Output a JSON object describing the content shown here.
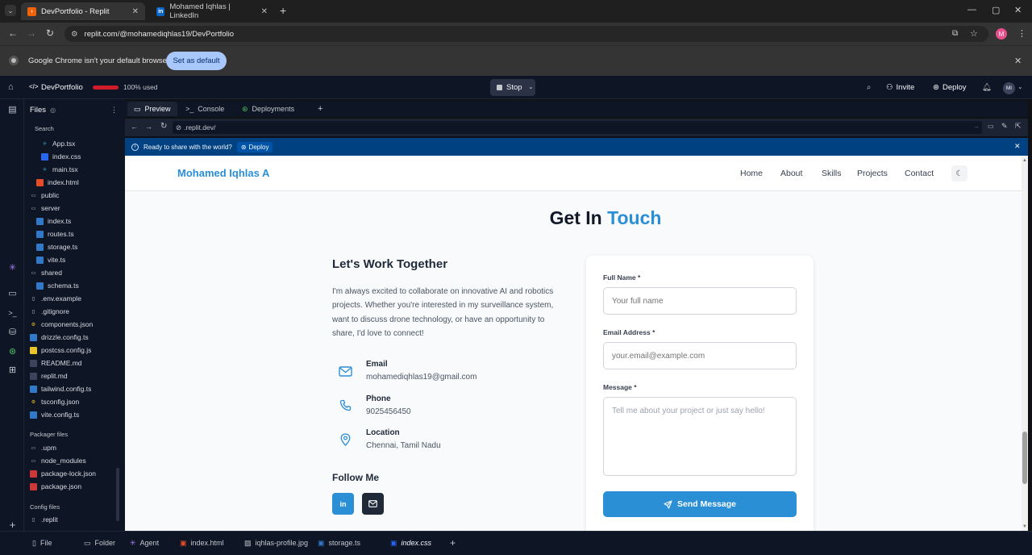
{
  "browser": {
    "tabs": [
      {
        "title": "DevPortfolio - Replit",
        "active": true
      },
      {
        "title": "Mohamed Iqhlas | LinkedIn",
        "active": false
      }
    ],
    "url": "replit.com/@mohamediqhlas19/DevPortfolio",
    "avatar_initial": "M",
    "infobar_text": "Google Chrome isn't your default browser",
    "set_default_label": "Set as default"
  },
  "replit": {
    "project_name": "DevPortfolio",
    "usage_label": "100% used",
    "stop_label": "Stop",
    "invite_label": "Invite",
    "deploy_label": "Deploy",
    "user_initials": "MI",
    "files_title": "Files",
    "search_label": "Search",
    "file_tree": [
      {
        "name": "App.tsx",
        "type": "react"
      },
      {
        "name": "index.css",
        "type": "css"
      },
      {
        "name": "main.tsx",
        "type": "react"
      },
      {
        "name": "index.html",
        "type": "html"
      },
      {
        "name": "public",
        "type": "folder"
      },
      {
        "name": "server",
        "type": "folder"
      },
      {
        "name": "index.ts",
        "type": "ts"
      },
      {
        "name": "routes.ts",
        "type": "ts"
      },
      {
        "name": "storage.ts",
        "type": "ts"
      },
      {
        "name": "vite.ts",
        "type": "ts"
      },
      {
        "name": "shared",
        "type": "folder"
      },
      {
        "name": "schema.ts",
        "type": "ts"
      },
      {
        "name": ".env.example",
        "type": "file"
      },
      {
        "name": ".gitignore",
        "type": "file"
      },
      {
        "name": "components.json",
        "type": "json"
      },
      {
        "name": "drizzle.config.ts",
        "type": "ts"
      },
      {
        "name": "postcss.config.js",
        "type": "js"
      },
      {
        "name": "README.md",
        "type": "md"
      },
      {
        "name": "replit.md",
        "type": "md"
      },
      {
        "name": "tailwind.config.ts",
        "type": "ts"
      },
      {
        "name": "tsconfig.json",
        "type": "json"
      },
      {
        "name": "vite.config.ts",
        "type": "ts"
      }
    ],
    "packager_title": "Packager files",
    "packager_files": [
      {
        "name": ".upm",
        "type": "folder"
      },
      {
        "name": "node_modules",
        "type": "folder"
      },
      {
        "name": "package-lock.json",
        "type": "npm"
      },
      {
        "name": "package.json",
        "type": "npm"
      }
    ],
    "config_title": "Config files",
    "config_files": [
      {
        "name": ".replit",
        "type": "file"
      }
    ],
    "new_file_label": "File",
    "new_folder_label": "Folder",
    "workspace_tabs": [
      "Preview",
      "Console",
      "Deployments"
    ],
    "preview_url": ".replit.dev/",
    "deploy_banner_text": "Ready to share with the world?",
    "deploy_banner_button": "Deploy",
    "bottom_tabs": [
      "Agent",
      "index.html",
      "iqhlas-profile.jpg",
      "storage.ts",
      "index.css"
    ]
  },
  "site": {
    "brand": "Mohamed Iqhlas A",
    "nav": [
      "Home",
      "About",
      "Skills",
      "Projects",
      "Contact"
    ],
    "heading_main": "Get In",
    "heading_accent": "Touch",
    "subheading": "Let's Work Together",
    "intro": "I'm always excited to collaborate on innovative AI and robotics projects. Whether you're interested in my surveillance system, want to discuss drone technology, or have an opportunity to share, I'd love to connect!",
    "contacts": [
      {
        "label": "Email",
        "value": "mohamediqhlas19@gmail.com",
        "icon": "mail-icon"
      },
      {
        "label": "Phone",
        "value": "9025456450",
        "icon": "phone-icon"
      },
      {
        "label": "Location",
        "value": "Chennai, Tamil Nadu",
        "icon": "map-pin-icon"
      }
    ],
    "follow_title": "Follow Me",
    "form": {
      "name_label": "Full Name *",
      "name_placeholder": "Your full name",
      "email_label": "Email Address *",
      "email_placeholder": "your.email@example.com",
      "message_label": "Message *",
      "message_placeholder": "Tell me about your project or just say hello!",
      "submit_label": "Send Message"
    },
    "accent_color": "#2b8fd6"
  }
}
